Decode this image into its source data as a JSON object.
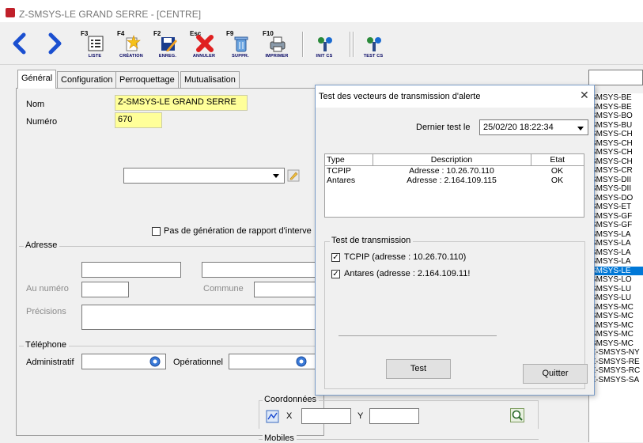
{
  "app": {
    "title": "Z-SMSYS-LE GRAND SERRE - [CENTRE]",
    "icon_color": "#c0202a"
  },
  "toolbar": {
    "buttons": [
      {
        "fkey": "F3",
        "label": "LISTE"
      },
      {
        "fkey": "F4",
        "label": "CRÉATION"
      },
      {
        "fkey": "F2",
        "label": "ENREG."
      },
      {
        "fkey": "Esc",
        "label": "ANNULER"
      },
      {
        "fkey": "F9",
        "label": "SUPPR."
      },
      {
        "fkey": "F10",
        "label": "IMPRIMER"
      },
      {
        "fkey": "",
        "label": "INIT CS"
      },
      {
        "fkey": "",
        "label": "TEST CS"
      }
    ]
  },
  "tabs": [
    "Général",
    "Configuration",
    "Perroquettage",
    "Mutualisation"
  ],
  "general": {
    "nom_label": "Nom",
    "nom_value": "Z-SMSYS-LE GRAND SERRE",
    "numero_label": "Numéro",
    "numero_value": "670",
    "rapport_checkbox_label": "Pas de génération de rapport d'interve",
    "adresse_group": "Adresse",
    "au_numero_label": "Au numéro",
    "commune_label": "Commune",
    "precisions_label": "Précisions",
    "telephone_group": "Téléphone",
    "administratif_label": "Administratif",
    "operationnel_label": "Opérationnel",
    "coordonnees_group": "Coordonnées",
    "x_label": "X",
    "y_label": "Y",
    "mobiles_group": "Mobiles"
  },
  "list": {
    "items": [
      "SMSYS-BE",
      "SMSYS-BE",
      "SMSYS-BO",
      "SMSYS-BU",
      "SMSYS-CH",
      "SMSYS-CH",
      "SMSYS-CH",
      "SMSYS-CH",
      "SMSYS-CR",
      "SMSYS-DII",
      "SMSYS-DII",
      "SMSYS-DO",
      "SMSYS-ET",
      "SMSYS-GF",
      "SMSYS-GF",
      "SMSYS-LA",
      "SMSYS-LA",
      "SMSYS-LA",
      "SMSYS-LA",
      "SMSYS-LE",
      "SMSYS-LO",
      "SMSYS-LU",
      "SMSYS-LU",
      "SMSYS-MC",
      "SMSYS-MC",
      "SMSYS-MC",
      "SMSYS-MC",
      "SMSYS-MC",
      "Z-SMSYS-NY",
      "Z-SMSYS-RE",
      "Z-SMSYS-RC",
      "Z-SMSYS-SA"
    ],
    "selected_index": 19,
    "selected_color": "#0078d7"
  },
  "dialog": {
    "title": "Test des vecteurs de transmission d'alerte",
    "close_glyph": "✕",
    "dernier_test_label": "Dernier test le",
    "dernier_test_value": "25/02/20 18:22:34",
    "table_headers": [
      "Type",
      "Description",
      "Etat"
    ],
    "table_rows": [
      {
        "type": "TCPIP",
        "description": "Adresse : 10.26.70.110",
        "etat": "OK"
      },
      {
        "type": "Antares",
        "description": "Adresse : 2.164.109.115",
        "etat": "OK"
      }
    ],
    "test_group_title": "Test de transmission",
    "checks": [
      {
        "label": "TCPIP (adresse : 10.26.70.110)",
        "checked": true
      },
      {
        "label": "Antares (adresse : 2.164.109.11!",
        "checked": true
      }
    ],
    "check_mark": "✓",
    "test_button": "Test",
    "quit_button": "Quitter"
  }
}
